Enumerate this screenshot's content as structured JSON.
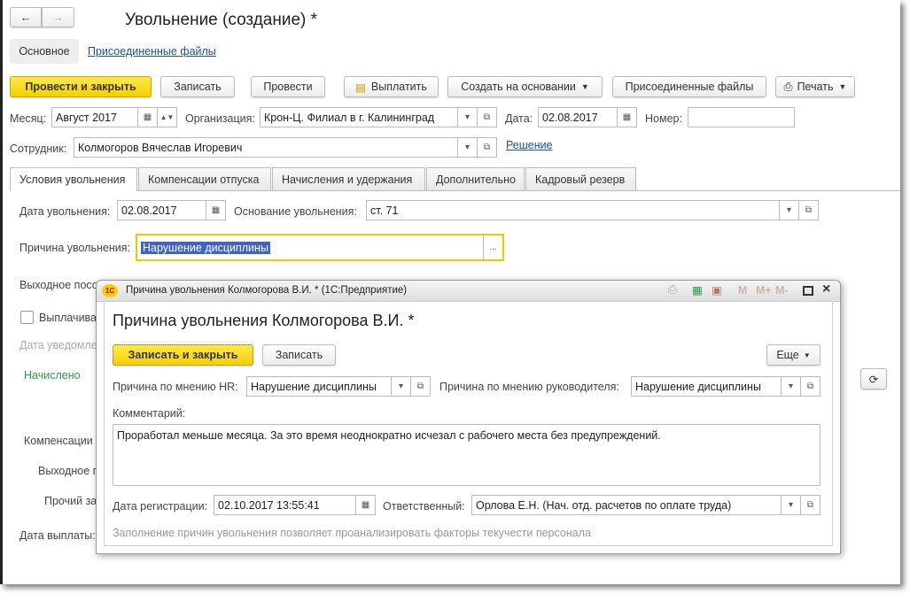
{
  "main": {
    "title": "Увольнение (создание) *",
    "nav": {
      "back": "←",
      "forward": "→"
    },
    "sections": [
      "Основное",
      "Присоединенные файлы"
    ],
    "toolbar": {
      "post_close": "Провести и закрыть",
      "save": "Записать",
      "post": "Провести",
      "pay": "Выплатить",
      "create_based": "Создать на основании",
      "attached": "Присоединенные файлы",
      "print": "Печать"
    },
    "fields": {
      "month_label": "Месяц:",
      "month": "Август 2017",
      "org_label": "Организация:",
      "org": "Крон-Ц. Филиал в г. Калининград",
      "date_label": "Дата:",
      "date": "02.08.2017",
      "number_label": "Номер:",
      "number": "",
      "employee_label": "Сотрудник:",
      "employee": "Колмогоров Вячеслав Игоревич",
      "decision_link": "Решение"
    },
    "tabs": [
      "Условия увольнения",
      "Компенсации отпуска",
      "Начисления и удержания",
      "Дополнительно",
      "Кадровый резерв"
    ],
    "conditions": {
      "dismissal_date_label": "Дата увольнения:",
      "dismissal_date": "02.08.2017",
      "basis_label": "Основание увольнения:",
      "basis": "ст. 71",
      "reason_label": "Причина увольнения:",
      "reason": "Нарушение дисциплины",
      "severance_label": "Выходное пособ",
      "pay_checkbox": "Выплачива",
      "notice_label": "Дата уведомле",
      "accrued": "Начислено",
      "comp_label": "Компенсации",
      "severance2": "Выходное п",
      "other": "Прочий за",
      "pay_date_label": "Дата выплаты:"
    }
  },
  "dialog": {
    "window_title": "Причина увольнения Колмогорова В.И. * (1С:Предприятие)",
    "title": "Причина увольнения Колмогорова В.И. *",
    "titlebar_icons": [
      "print-icon",
      "calculator-icon",
      "calendar-icon",
      "M",
      "M+",
      "M-",
      "maximize-icon",
      "close-icon"
    ],
    "save_close": "Записать и закрыть",
    "save": "Записать",
    "more": "Еще",
    "hr_label": "Причина по мнению HR:",
    "hr_value": "Нарушение дисциплины",
    "mgr_label": "Причина по мнению руководителя:",
    "mgr_value": "Нарушение дисциплины",
    "comment_label": "Комментарий:",
    "comment": "Проработал меньше месяца. За это время неоднократно исчезал с рабочего места без предупреждений.",
    "reg_date_label": "Дата регистрации:",
    "reg_date": "02.10.2017 13:55:41",
    "resp_label": "Ответственный:",
    "resp": "Орлова Е.Н. (Нач. отд. расчетов по оплате труда)",
    "hint": "Заполнение причин увольнения позволяет проанализировать факторы текучести персонала"
  },
  "colors": {
    "accent_yellow": "#f5d000",
    "link": "#1a4fa0",
    "green": "#2a9a4a",
    "selection": "#3f63c8"
  }
}
